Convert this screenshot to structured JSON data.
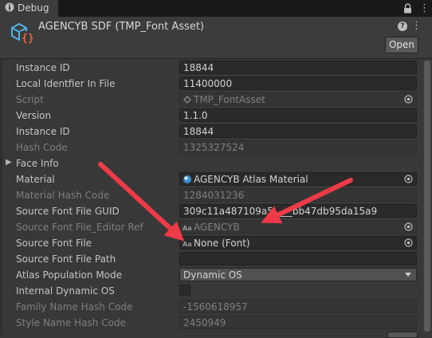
{
  "tab": {
    "title": "Debug",
    "icon": "debug-info-icon"
  },
  "header": {
    "title": "AGENCYB SDF (TMP_Font Asset)",
    "open_label": "Open",
    "asset_icon": "font-asset-icon"
  },
  "rows": [
    {
      "label": "Instance ID",
      "value": "18844",
      "enabled": true
    },
    {
      "label": "Local Identfier In File",
      "value": "11400000",
      "enabled": true
    },
    {
      "label": "Script",
      "value": "TMP_FontAsset",
      "enabled": false,
      "icon": "script-icon",
      "picker": true
    },
    {
      "label": "Version",
      "value": "1.1.0",
      "enabled": true
    },
    {
      "label": "Instance ID",
      "value": "18844",
      "enabled": true
    },
    {
      "label": "Hash Code",
      "value": "1325327524",
      "enabled": false
    },
    {
      "label": "Face Info",
      "foldout": true
    },
    {
      "label": "Material",
      "value": "AGENCYB Atlas Material",
      "enabled": true,
      "icon": "material-icon",
      "picker": true
    },
    {
      "label": "Material Hash Code",
      "value": "1284031236",
      "enabled": false
    },
    {
      "label": "Source Font File GUID",
      "value": "309c11a487109a5____bb47db95da15a9",
      "enabled": true
    },
    {
      "label": "Source Font File_Editor Ref",
      "value": "AGENCYB",
      "enabled": false,
      "icon": "font-file-icon",
      "picker": true
    },
    {
      "label": "Source Font File",
      "value": "None (Font)",
      "enabled": true,
      "icon": "font-file-icon",
      "picker": true
    },
    {
      "label": "Source Font File Path",
      "value": "",
      "enabled": true
    },
    {
      "label": "Atlas Population Mode",
      "value": "Dynamic OS",
      "enabled": true,
      "dropdown": true
    },
    {
      "label": "Internal Dynamic OS",
      "checkbox": true,
      "checked": false,
      "enabled": true
    },
    {
      "label": "Family Name Hash Code",
      "value": "-1560618957",
      "enabled": false
    },
    {
      "label": "Style Name Hash Code",
      "value": "2450949",
      "enabled": false
    }
  ],
  "colors": {
    "annotation_arrow": "#ee3b47",
    "panel": "#383838"
  }
}
